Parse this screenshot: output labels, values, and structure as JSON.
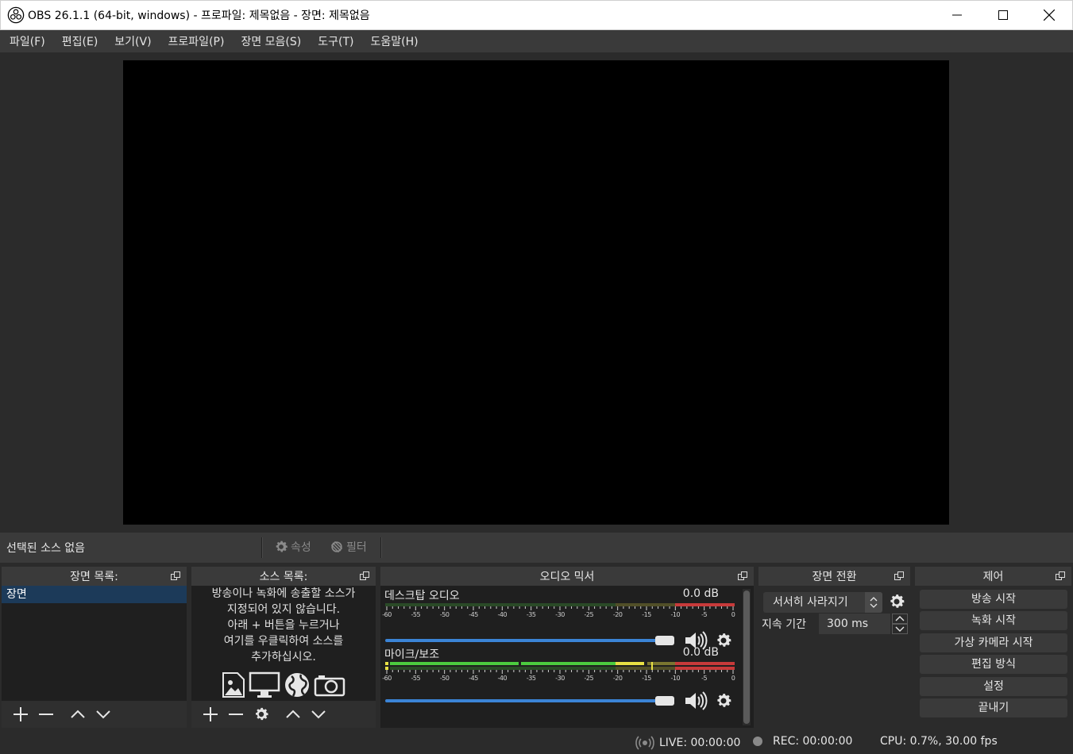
{
  "window": {
    "title": "OBS 26.1.1 (64-bit, windows) - 프로파일: 제목없음 - 장면: 제목없음"
  },
  "menu": [
    "파일(F)",
    "편집(E)",
    "보기(V)",
    "프로파일(P)",
    "장면 모음(S)",
    "도구(T)",
    "도움말(H)"
  ],
  "context": {
    "no_source": "선택된 소스 없음",
    "properties": "속성",
    "filters": "필터"
  },
  "scenes": {
    "title": "장면 목록:",
    "items": [
      "장면"
    ]
  },
  "sources": {
    "title": "소스 목록:",
    "hint_lines": [
      "방송이나 녹화에 송출할 소스가",
      "지정되어 있지 않습니다.",
      "아래 + 버튼을 누르거나",
      "여기를 우클릭하여 소스를",
      "추가하십시오."
    ]
  },
  "mixer": {
    "title": "오디오 믹서",
    "ticks": [
      "-60",
      "-55",
      "-50",
      "-45",
      "-40",
      "-35",
      "-30",
      "-25",
      "-20",
      "-15",
      "-10",
      "-5",
      "0"
    ],
    "channels": [
      {
        "name": "데스크탑 오디오",
        "db": "0.0 dB",
        "volume": 1.0
      },
      {
        "name": "마이크/보조",
        "db": "0.0 dB",
        "volume": 1.0
      }
    ]
  },
  "transitions": {
    "title": "장면 전환",
    "selected": "서서히 사라지기",
    "duration_label": "지속 기간",
    "duration_value": "300 ms"
  },
  "controls": {
    "title": "제어",
    "buttons": [
      "방송 시작",
      "녹화 시작",
      "가상 카메라 시작",
      "편집 방식",
      "설정",
      "끝내기"
    ]
  },
  "status": {
    "live": "LIVE: 00:00:00",
    "rec": "REC: 00:00:00",
    "cpu": "CPU: 0.7%, 30.00 fps"
  },
  "colors": {
    "meter_green": "#4ccb3f",
    "meter_yellow": "#e8e044",
    "meter_red": "#c73a3a",
    "slider_blue": "#3b84d6",
    "selected_scene": "#1c3a59"
  }
}
